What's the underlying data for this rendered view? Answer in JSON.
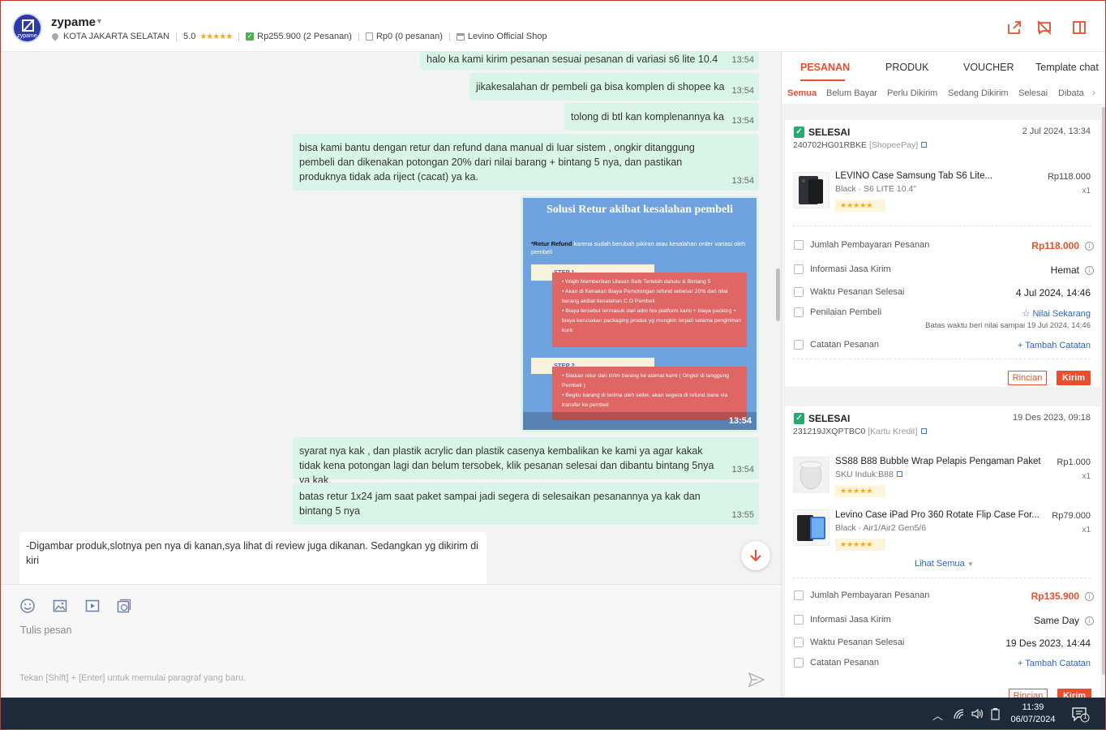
{
  "header": {
    "shop_name": "zypame",
    "avatar_text": "zypame",
    "location": "KOTA JAKARTA SELATAN",
    "rating": "5.0",
    "total_spent": "Rp255.900 (2 Pesanan)",
    "pending": "Rp0 (0 pesanan)",
    "store": "Levino Official Shop"
  },
  "messages": [
    {
      "text": "halo ka kami kirim pesanan sesuai pesanan di variasi s6 lite  10.4",
      "time": "13:54"
    },
    {
      "text": "jikakesalahan dr pembeli ga bisa komplen di shopee ka",
      "time": "13:54"
    },
    {
      "text": "tolong di btl kan komplenannya ka",
      "time": "13:54"
    },
    {
      "text": "bisa kami bantu dengan retur dan refund dana manual di luar sistem , ongkir ditanggung pembeli dan dikenakan potongan 20% dari nilai barang + bintang 5 nya, dan pastikan produknya tidak ada riject (cacat) ya ka.",
      "time": "13:54"
    },
    {
      "text": "syarat nya kak , dan plastik acrylic dan plastik casenya kembalikan ke kami ya agar kakak tidak kena potongan lagi dan belum tersobek, klik pesanan selesai dan dibantu bintang 5nya ya kak.",
      "time": "13:54"
    },
    {
      "text": "batas retur 1x24 jam saat paket sampai jadi segera di selesaikan pesanannya ya kak dan bintang 5 nya",
      "time": "13:55"
    },
    {
      "text": "-Digambar produk,slotnya pen nya di kanan,sya lihat di review juga dikanan. Sedangkan yg dikirim di kiri",
      "time": ""
    }
  ],
  "image_message": {
    "title": "Solusi Retur akibat kesalahan pembeli",
    "subtitle_bold": "*Retur Refund",
    "subtitle": " karena sudah berubah pikiran atau kesalahan order variasi oleh pembeli",
    "step1": "STEP 1",
    "step1_items": [
      "Wajib Memberikan Ulasan Baik Terlebih dahulu & Bintang 5",
      "Akan di Kenakan Biaya Pemotongan refund sebesar 20% dari nilai barang akibat kesalahan C.O Pembeli",
      "Biaya tersebut termasuk dari adm fee platform kami + biaya packing + biaya kerusakan packaging produk yg mungkin terjadi selama pengiriman kurir."
    ],
    "step2": "STEP 2",
    "step2_items": [
      "Silakan retur dan kirim barang ke alamat kami ( Ongkir di tanggung Pembeli )",
      "Begitu barang di terima oleh seller, akan segera di refund dana via transfer ke pembeli"
    ],
    "time": "13:54"
  },
  "composer": {
    "placeholder": "Tulis pesan",
    "hint": "Tekan [Shift] + [Enter] untuk memulai paragraf yang baru."
  },
  "panel": {
    "tabs": [
      "PESANAN",
      "PRODUK",
      "VOUCHER",
      "Template chat"
    ],
    "subtabs": [
      "Semua",
      "Belum Bayar",
      "Perlu Dikirim",
      "Sedang Dikirim",
      "Selesai",
      "Dibata"
    ],
    "orders": [
      {
        "status": "SELESAI",
        "date": "2 Jul 2024, 13:34",
        "order_id": "240702HG01RBKE",
        "payment": "[ShopeePay]",
        "products": [
          {
            "name": "LEVINO Case Samsung Tab S6 Lite...",
            "variant": "Black · S6 LITE 10.4\"",
            "price": "Rp118.000",
            "qty": "x1",
            "stars": "★★★★★"
          }
        ],
        "rows": [
          {
            "label": "Jumlah Pembayaran Pesanan",
            "value": "Rp118.000"
          },
          {
            "label": "Informasi Jasa Kirim",
            "value": "Hemat"
          },
          {
            "label": "Waktu Pesanan Selesai",
            "value": "4 Jul 2024, 14:46"
          },
          {
            "label": "Penilaian Pembeli",
            "value": "☆ Nilai Sekarang",
            "note": "Batas waktu beri nilai sampai 19 Jul 2024, 14:46"
          },
          {
            "label": "Catatan Pesanan",
            "value": "+ Tambah Catatan"
          }
        ],
        "btn_detail": "Rincian",
        "btn_send": "Kirim"
      },
      {
        "status": "SELESAI",
        "date": "19 Des 2023, 09:18",
        "order_id": "231219JXQPTBC0",
        "payment": "[Kartu Kredit]",
        "products": [
          {
            "name": "SS88 B88 Bubble Wrap Pelapis Pengaman Paket",
            "variant": "SKU Induk:B88",
            "price": "Rp1.000",
            "qty": "x1",
            "stars": "★★★★★"
          },
          {
            "name": "Levino Case iPad Pro 360 Rotate Flip Case For...",
            "variant": "Black · Air1/Air2 Gen5/6",
            "price": "Rp79.000",
            "qty": "x1",
            "stars": "★★★★★"
          }
        ],
        "see_all": "Lihat Semua",
        "rows": [
          {
            "label": "Jumlah Pembayaran Pesanan",
            "value": "Rp135.900"
          },
          {
            "label": "Informasi Jasa Kirim",
            "value": "Same Day"
          },
          {
            "label": "Waktu Pesanan Selesai",
            "value": "19 Des 2023, 14:44"
          },
          {
            "label": "Catatan Pesanan",
            "value": "+ Tambah Catatan"
          }
        ],
        "btn_detail": "Rincian",
        "btn_send": "Kirim"
      }
    ]
  },
  "taskbar": {
    "time": "11:39",
    "date": "06/07/2024",
    "notification_count": "1"
  },
  "colors": {
    "accent": "#ee4d2d",
    "bubble_out": "#d9f5e9",
    "taskbar": "#1c2a3a"
  }
}
